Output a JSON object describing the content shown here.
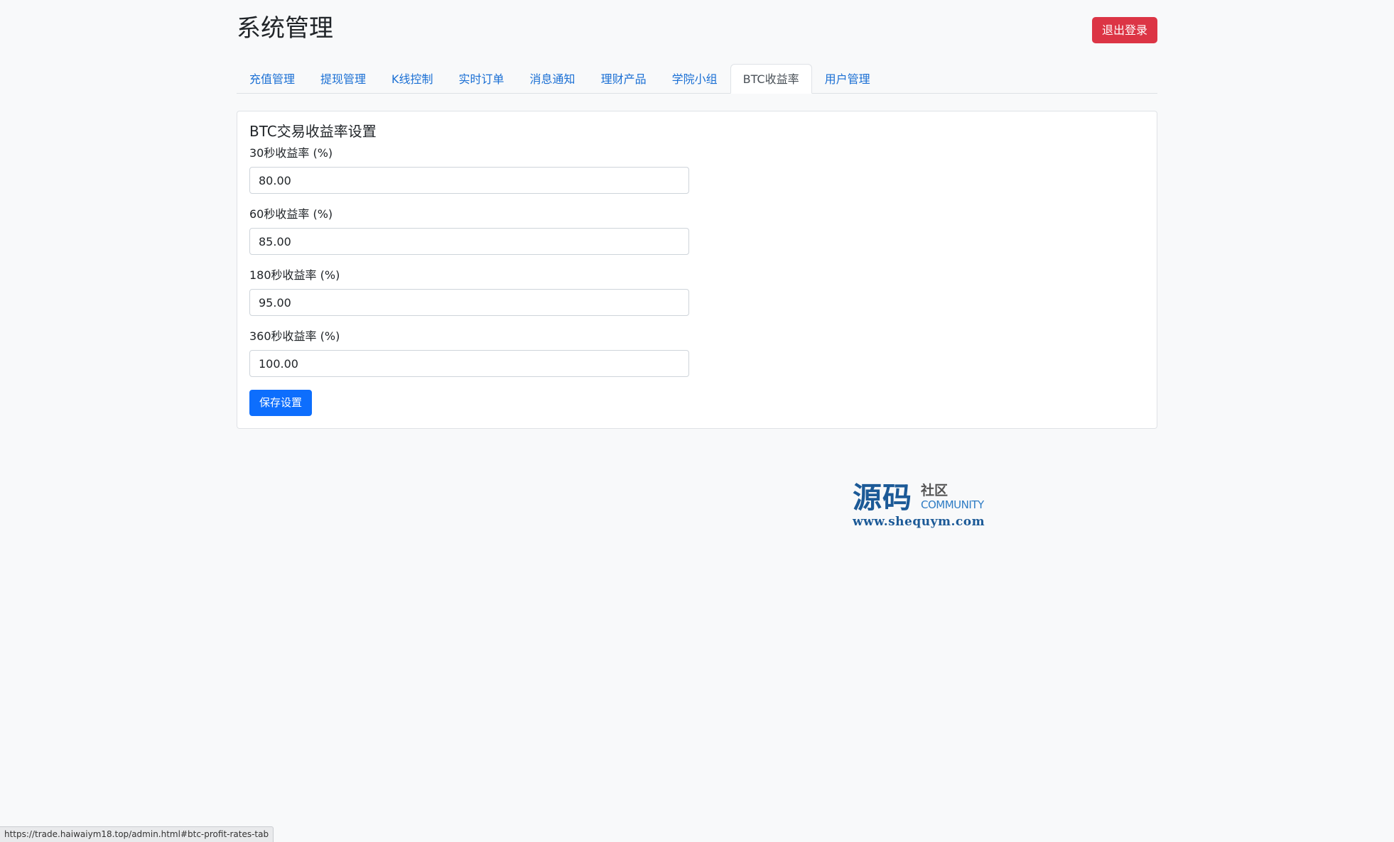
{
  "header": {
    "title": "系统管理",
    "logout_label": "退出登录"
  },
  "tabs": [
    {
      "label": "充值管理"
    },
    {
      "label": "提现管理"
    },
    {
      "label": "K线控制"
    },
    {
      "label": "实时订单"
    },
    {
      "label": "消息通知"
    },
    {
      "label": "理财产品"
    },
    {
      "label": "学院小组"
    },
    {
      "label": "BTC收益率",
      "active": true
    },
    {
      "label": "用户管理"
    }
  ],
  "card": {
    "title": "BTC交易收益率设置",
    "fields": [
      {
        "label": "30秒收益率 (%)",
        "value": "80.00"
      },
      {
        "label": "60秒收益率 (%)",
        "value": "85.00"
      },
      {
        "label": "180秒收益率 (%)",
        "value": "95.00"
      },
      {
        "label": "360秒收益率 (%)",
        "value": "100.00"
      }
    ],
    "save_label": "保存设置"
  },
  "watermark": {
    "zh": "源码",
    "sq": "社区",
    "community": "COMMUNITY",
    "url": "www.shequym.com"
  },
  "status_bar": {
    "url": "https://trade.haiwaiym18.top/admin.html#btc-profit-rates-tab"
  },
  "colors": {
    "background": "#f8f9fa",
    "primary": "#0d6efd",
    "danger": "#dc3545",
    "tab_link": "#1a6fd4"
  }
}
